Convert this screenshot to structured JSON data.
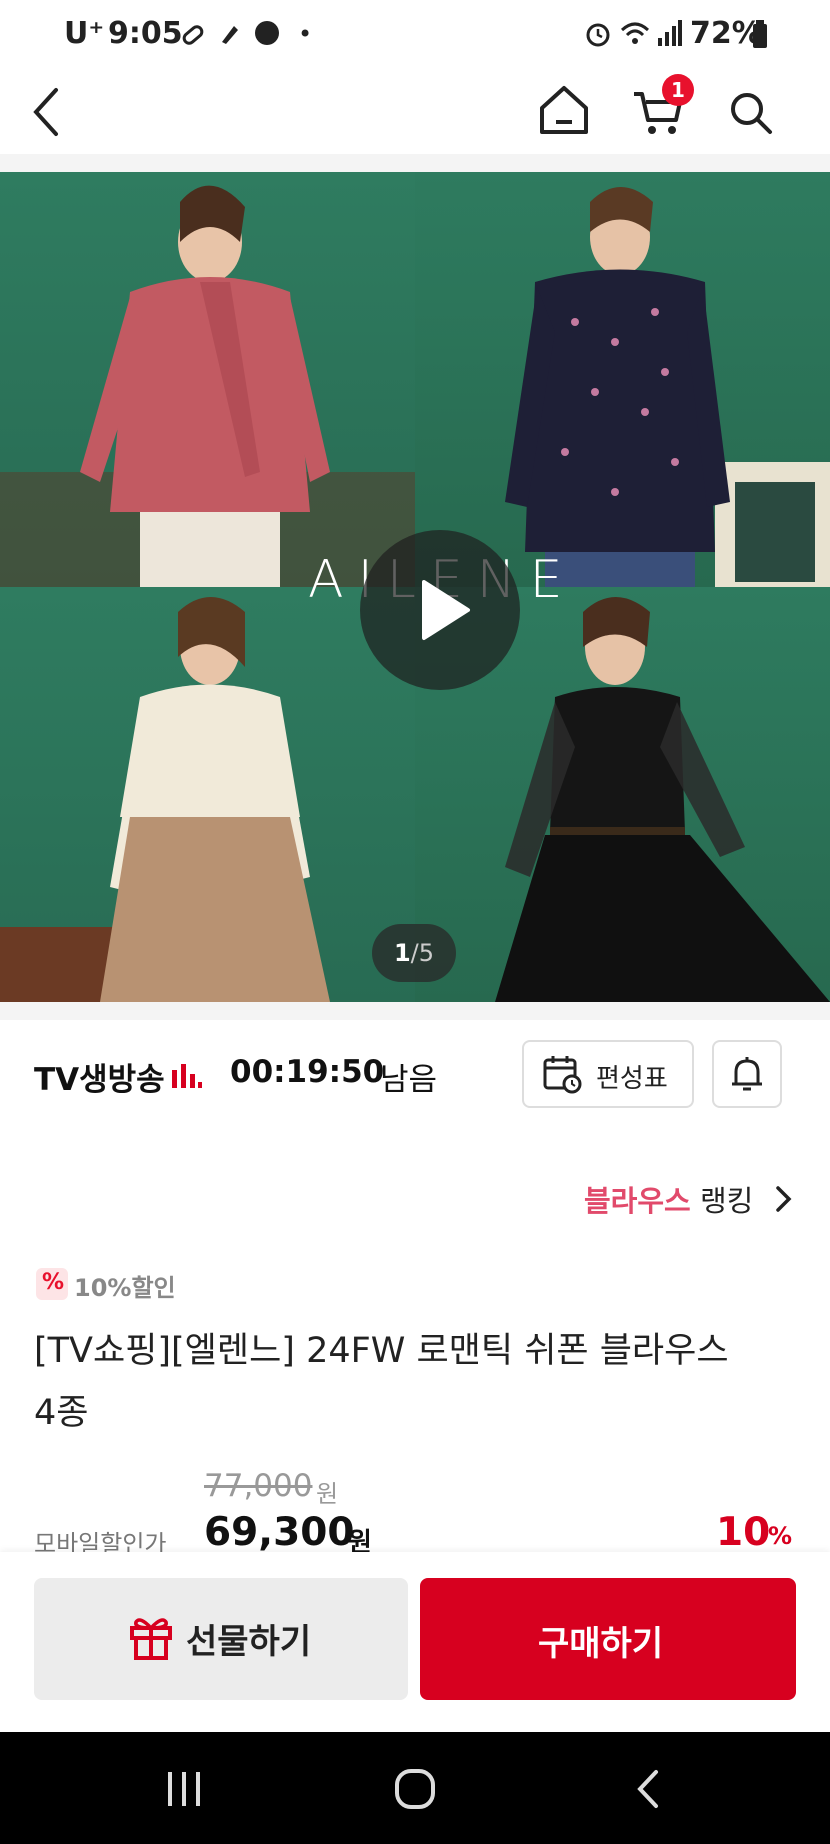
{
  "status_bar": {
    "carrier": "U⁺",
    "time": "9:05",
    "dot": "•",
    "battery": "72%"
  },
  "header": {
    "cart_count": "1"
  },
  "hero": {
    "brand_watermark": "AILENE",
    "page_current": "1",
    "page_total": "/5"
  },
  "live": {
    "label": "TV생방송",
    "countdown": "00:19:50",
    "remaining": "남음",
    "schedule_label": "편성표"
  },
  "ranking": {
    "category": "블라우스",
    "label": "랭킹"
  },
  "product": {
    "discount_tag": "10%할인",
    "title_line1": "[TV쇼핑][엘렌느] 24FW 로맨틱 쉬폰 블라우스",
    "title_line2": "4종",
    "original_price": "77,000",
    "original_unit": "원",
    "price_label": "모바일할인가",
    "sale_price": "69,300",
    "sale_unit": "원",
    "discount_rate": "10",
    "discount_percent": "%"
  },
  "actions": {
    "gift_label": "선물하기",
    "buy_label": "구매하기"
  },
  "colors": {
    "brand_red": "#d7001f",
    "ranking_pink": "#e14a6b",
    "hero_green": "#2d7a5e"
  }
}
